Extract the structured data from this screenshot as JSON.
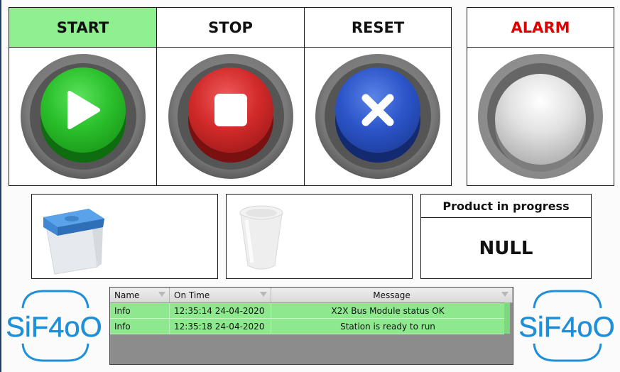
{
  "controls": {
    "start": {
      "label": "START",
      "icon": "play-icon",
      "header_color": "#8ef08e"
    },
    "stop": {
      "label": "STOP",
      "icon": "stop-icon"
    },
    "reset": {
      "label": "RESET",
      "icon": "x-icon"
    },
    "alarm": {
      "label": "ALARM",
      "label_color": "#e00000",
      "icon": "alarm-lamp-icon"
    }
  },
  "images": {
    "container_with_lid": "box-container-icon",
    "cup": "cup-icon"
  },
  "product": {
    "label": "Product in progress",
    "value": "NULL"
  },
  "log": {
    "columns": [
      "Name",
      "On Time",
      "Message"
    ],
    "rows": [
      {
        "name": "Info",
        "time": "12:35:14 24-04-2020",
        "message": "X2X Bus Module status OK"
      },
      {
        "name": "Info",
        "time": "12:35:18 24-04-2020",
        "message": "Station is ready to run"
      }
    ],
    "row_color": "#8ee98e"
  },
  "branding": {
    "logo_text": "SiF4oO",
    "logo_color": "#1f8fd8"
  }
}
